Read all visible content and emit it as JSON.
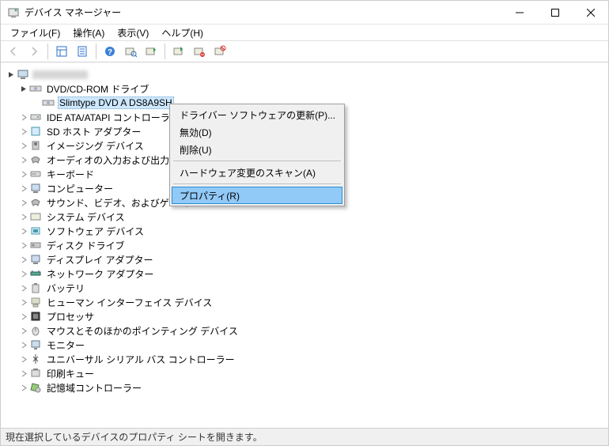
{
  "window": {
    "title": "デバイス マネージャー"
  },
  "menu": {
    "file": "ファイル(F)",
    "action": "操作(A)",
    "view": "表示(V)",
    "help": "ヘルプ(H)"
  },
  "tree": {
    "root": "",
    "dvd_category": "DVD/CD-ROM ドライブ",
    "dvd_device": "Slimtype DVD A  DS8A9SH",
    "items": [
      "IDE ATA/ATAPI コントローラー",
      "SD ホスト アダプター",
      "イメージング デバイス",
      "オーディオの入力および出力",
      "キーボード",
      "コンピューター",
      "サウンド、ビデオ、およびゲーム",
      "システム デバイス",
      "ソフトウェア デバイス",
      "ディスク ドライブ",
      "ディスプレイ アダプター",
      "ネットワーク アダプター",
      "バッテリ",
      "ヒューマン インターフェイス デバイス",
      "プロセッサ",
      "マウスとそのほかのポインティング デバイス",
      "モニター",
      "ユニバーサル シリアル バス コントローラー",
      "印刷キュー",
      "記憶域コントローラー"
    ]
  },
  "context_menu": {
    "update_driver": "ドライバー ソフトウェアの更新(P)...",
    "disable": "無効(D)",
    "uninstall": "削除(U)",
    "scan": "ハードウェア変更のスキャン(A)",
    "properties": "プロパティ(R)"
  },
  "status": "現在選択しているデバイスのプロパティ シートを開きます。"
}
